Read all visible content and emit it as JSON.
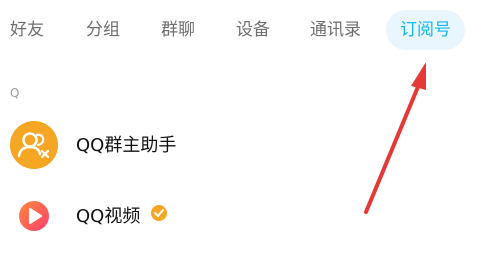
{
  "tabs": [
    {
      "label": "好友",
      "active": false
    },
    {
      "label": "分组",
      "active": false
    },
    {
      "label": "群聊",
      "active": false
    },
    {
      "label": "设备",
      "active": false
    },
    {
      "label": "通讯录",
      "active": false
    },
    {
      "label": "订阅号",
      "active": true
    }
  ],
  "section": {
    "letter": "Q"
  },
  "items": [
    {
      "name": "QQ群主助手",
      "icon": "group-assistant-icon",
      "color": "#f5a623"
    },
    {
      "name": "QQ视频",
      "icon": "video-play-icon",
      "verified": true,
      "color": "#ff5a5f"
    }
  ],
  "colors": {
    "accent": "#12b7f5",
    "active_tab_bg": "#e9f6fd",
    "annotation_arrow": "#e53935",
    "verified_badge": "#f5a623"
  }
}
